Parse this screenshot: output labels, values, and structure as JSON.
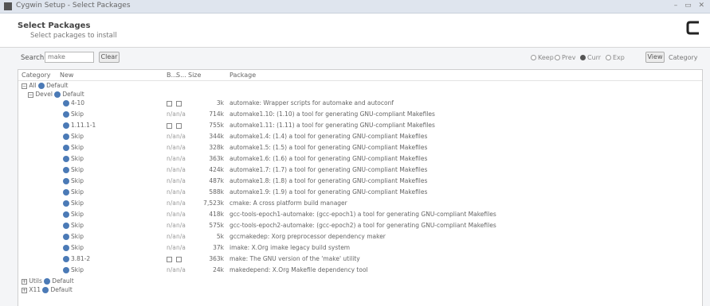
{
  "window": {
    "title": "Cygwin Setup - Select Packages"
  },
  "header": {
    "title": "Select Packages",
    "subtitle": "Select packages to install"
  },
  "toolbar": {
    "search_label": "Search",
    "search_value": "make",
    "clear_label": "Clear",
    "view_options": [
      {
        "label": "Keep",
        "selected": false
      },
      {
        "label": "Prev",
        "selected": false
      },
      {
        "label": "Curr",
        "selected": true
      },
      {
        "label": "Exp",
        "selected": false
      }
    ],
    "view_button": "View",
    "category_label": "Category"
  },
  "columns": {
    "category": "Category",
    "new": "New",
    "bin": "B...",
    "src": "S...",
    "size": "Size",
    "package": "Package"
  },
  "tree": {
    "all": "All",
    "all_state": "Default",
    "devel": "Devel",
    "devel_state": "Default",
    "utils": "Utils",
    "utils_state": "Default",
    "x11": "X11",
    "x11_state": "Default"
  },
  "rows": [
    {
      "new": "4-10",
      "bin": "box",
      "src": "box",
      "size": "3k",
      "package": "automake: Wrapper scripts for automake and autoconf"
    },
    {
      "new": "Skip",
      "bin": "n/a",
      "src": "n/a",
      "size": "714k",
      "package": "automake1.10: (1.10) a tool for generating GNU-compliant Makefiles"
    },
    {
      "new": "1.11.1-1",
      "bin": "box",
      "src": "box",
      "size": "755k",
      "package": "automake1.11: (1.11) a tool for generating GNU-compliant Makefiles"
    },
    {
      "new": "Skip",
      "bin": "n/a",
      "src": "n/a",
      "size": "344k",
      "package": "automake1.4: (1.4) a tool for generating GNU-compliant Makefiles"
    },
    {
      "new": "Skip",
      "bin": "n/a",
      "src": "n/a",
      "size": "328k",
      "package": "automake1.5: (1.5) a tool for generating GNU-compliant Makefiles"
    },
    {
      "new": "Skip",
      "bin": "n/a",
      "src": "n/a",
      "size": "363k",
      "package": "automake1.6: (1.6) a tool for generating GNU-compliant Makefiles"
    },
    {
      "new": "Skip",
      "bin": "n/a",
      "src": "n/a",
      "size": "424k",
      "package": "automake1.7: (1.7) a tool for generating GNU-compliant Makefiles"
    },
    {
      "new": "Skip",
      "bin": "n/a",
      "src": "n/a",
      "size": "487k",
      "package": "automake1.8: (1.8) a tool for generating GNU-compliant Makefiles"
    },
    {
      "new": "Skip",
      "bin": "n/a",
      "src": "n/a",
      "size": "588k",
      "package": "automake1.9: (1.9) a tool for generating GNU-compliant Makefiles"
    },
    {
      "new": "Skip",
      "bin": "n/a",
      "src": "n/a",
      "size": "7,523k",
      "package": "cmake: A cross platform build manager"
    },
    {
      "new": "Skip",
      "bin": "n/a",
      "src": "n/a",
      "size": "418k",
      "package": "gcc-tools-epoch1-automake: (gcc-epoch1) a tool for generating GNU-compliant Makefiles"
    },
    {
      "new": "Skip",
      "bin": "n/a",
      "src": "n/a",
      "size": "575k",
      "package": "gcc-tools-epoch2-automake: (gcc-epoch2) a tool for generating GNU-compliant Makefiles"
    },
    {
      "new": "Skip",
      "bin": "n/a",
      "src": "n/a",
      "size": "5k",
      "package": "gccmakedep: Xorg preprocessor dependency maker"
    },
    {
      "new": "Skip",
      "bin": "n/a",
      "src": "n/a",
      "size": "37k",
      "package": "imake: X.Org imake legacy build system"
    },
    {
      "new": "3.81-2",
      "bin": "box",
      "src": "box",
      "size": "363k",
      "package": "make: The GNU version of the 'make' utility"
    },
    {
      "new": "Skip",
      "bin": "n/a",
      "src": "n/a",
      "size": "24k",
      "package": "makedepend: X.Org Makefile dependency tool"
    }
  ]
}
